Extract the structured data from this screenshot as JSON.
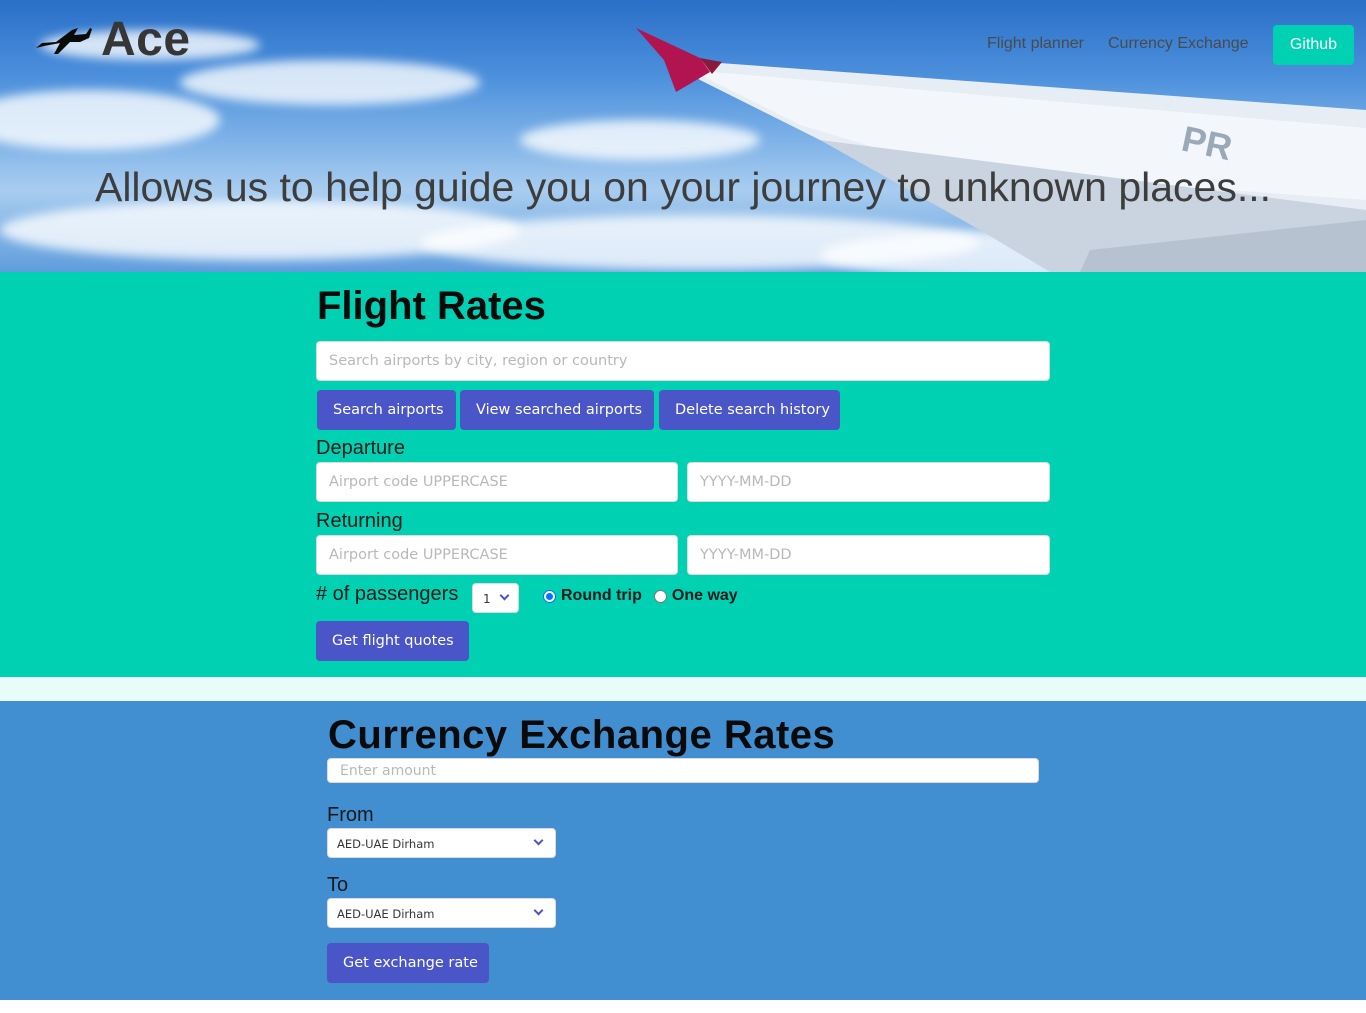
{
  "navbar": {
    "logo_icon": "airplane-icon",
    "brand": "Ace",
    "links": [
      "Flight planner",
      "Currency Exchange"
    ],
    "github_label": "Github"
  },
  "hero": {
    "tagline": "Allows us to help guide you on your journey to unknown places..."
  },
  "flight": {
    "title": "Flight Rates",
    "search_placeholder": "Search airports by city, region or country",
    "buttons": {
      "search": "Search airports",
      "view": "View searched airports",
      "delete": "Delete search history"
    },
    "departure_label": "Departure",
    "returning_label": "Returning",
    "airport_placeholder": "Airport code UPPERCASE",
    "date_placeholder": "YYYY-MM-DD",
    "passengers_label": "# of passengers",
    "passengers_value": "1",
    "trip_options": {
      "round": "Round trip",
      "oneway": "One way",
      "selected": "Round trip"
    },
    "quote_button": "Get flight quotes"
  },
  "currency": {
    "title": "Currency Exchange Rates",
    "amount_placeholder": "Enter amount",
    "from_label": "From",
    "to_label": "To",
    "from_value": "AED-UAE Dirham",
    "to_value": "AED-UAE Dirham",
    "rate_button": "Get exchange rate"
  },
  "colors": {
    "primary": "#00d1b2",
    "button": "#4a55c8",
    "currency_bg": "#418ed0",
    "strip": "#e8fdfa"
  }
}
